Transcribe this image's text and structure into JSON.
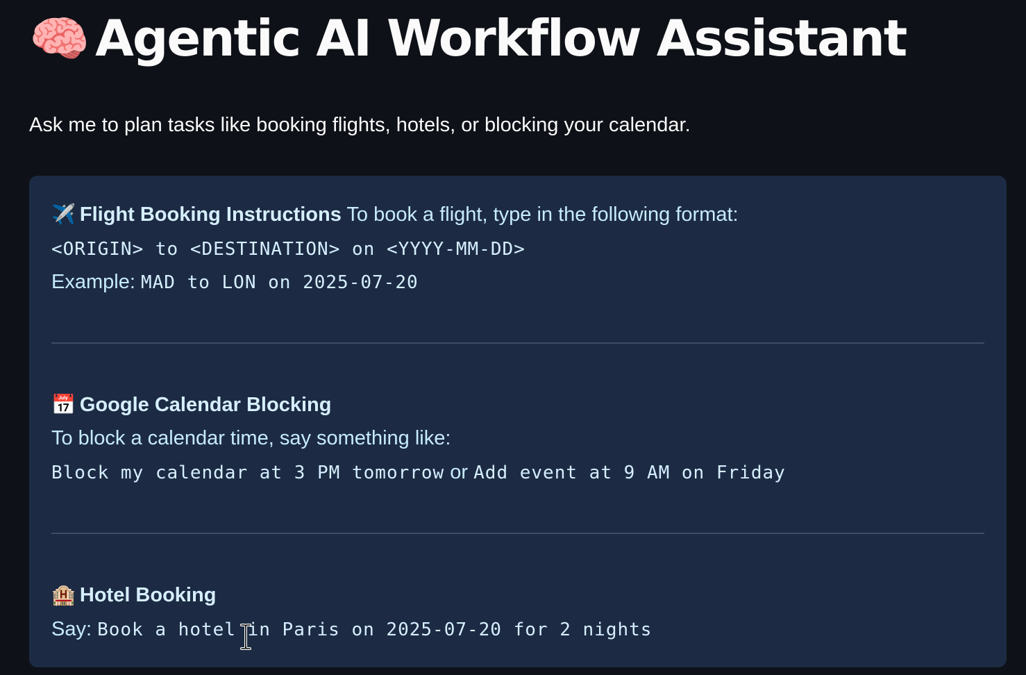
{
  "page": {
    "title_icon": "brain-icon",
    "title": "Agentic AI Workflow Assistant",
    "subtitle": "Ask me to plan tasks like booking flights, hotels, or blocking your calendar."
  },
  "info_box": {
    "flight": {
      "icon": "airplane-icon",
      "heading": "Flight Booking Instructions",
      "intro": "To book a flight, type in the following format:",
      "format": "<ORIGIN> to <DESTINATION> on <YYYY-MM-DD>",
      "example_label": "Example:",
      "example_value": "MAD to LON on 2025-07-20"
    },
    "calendar": {
      "icon": "calendar-icon",
      "heading": "Google Calendar Blocking",
      "intro": "To block a calendar time, say something like:",
      "example_1": "Block my calendar at 3 PM tomorrow",
      "or_text": "or",
      "example_2": "Add event at 9 AM on Friday"
    },
    "hotel": {
      "icon": "hotel-icon",
      "heading": "Hotel Booking",
      "say_label": "Say:",
      "example": "Book a hotel in Paris on 2025-07-20 for 2 nights"
    }
  },
  "colors": {
    "background": "#0e1117",
    "info_box_background": "#1c2b43",
    "info_text": "#c7ebff",
    "divider": "#3d4d64"
  }
}
